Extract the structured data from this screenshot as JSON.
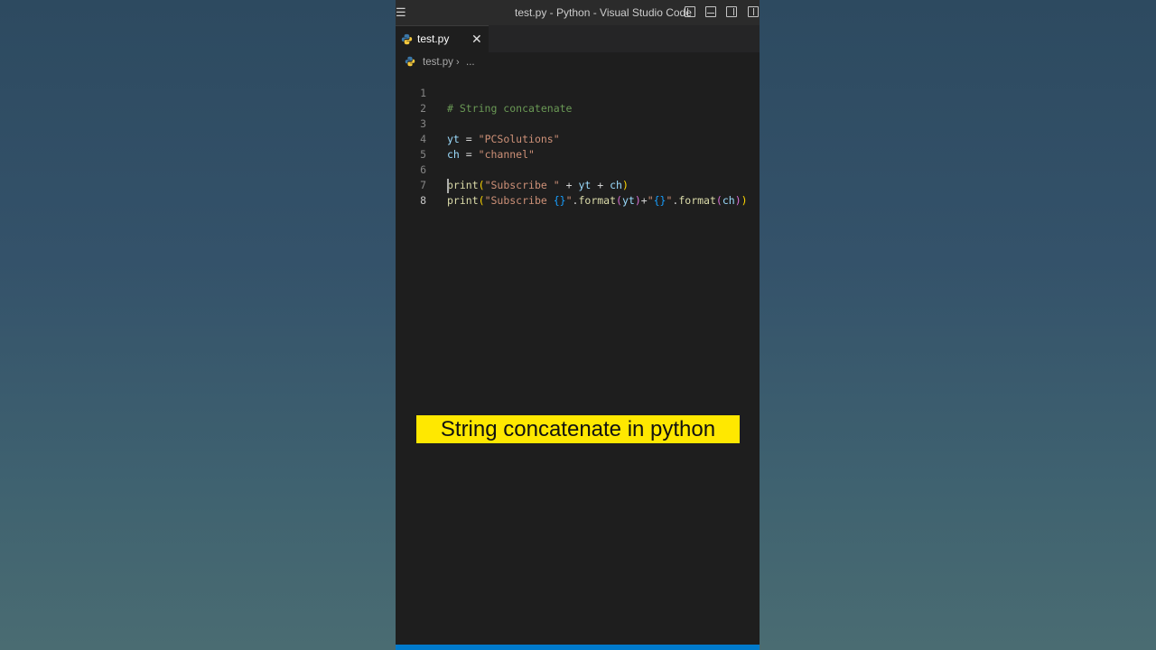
{
  "window": {
    "title": "test.py - Python - Visual Studio Code",
    "menu_icon": "hamburger-menu-icon",
    "layout_icons": [
      "toggle-primary-sidebar-icon",
      "toggle-panel-icon",
      "toggle-secondary-sidebar-icon",
      "customize-layout-icon"
    ]
  },
  "tab": {
    "label": "test.py",
    "close": "✕",
    "icon": "python-icon"
  },
  "breadcrumb": {
    "file": "test.py",
    "separator": "›",
    "more": "..."
  },
  "editor": {
    "line_numbers": [
      "1",
      "2",
      "3",
      "4",
      "5",
      "6",
      "7",
      "8"
    ],
    "active_line": "8",
    "code": {
      "l1_comment": "# String concatenate",
      "l3_var": "yt",
      "l3_eq": " = ",
      "l3_str": "\"PCSolutions\"",
      "l4_var": "ch",
      "l4_eq": " = ",
      "l4_str": "\"channel\"",
      "l6_fn": "print",
      "l6_open": "(",
      "l6_str": "\"Subscribe \"",
      "l6_plus1": " + ",
      "l6_v1": "yt",
      "l6_plus2": " + ",
      "l6_v2": "ch",
      "l6_close": ")",
      "l7_fn": "print",
      "l7_open": "(",
      "l7_str1a": "\"Subscribe ",
      "l7_brace1": "{}",
      "l7_str1b": "\"",
      "l7_dot1": ".",
      "l7_fmt1": "format",
      "l7_p1o": "(",
      "l7_v1": "yt",
      "l7_p1c": ")",
      "l7_plus": "+",
      "l7_str2a": "\"",
      "l7_brace2": "{}",
      "l7_str2b": "\"",
      "l7_dot2": ".",
      "l7_fmt2": "format",
      "l7_p2o": "(",
      "l7_v2": "ch",
      "l7_p2c": ")",
      "l7_close": ")"
    }
  },
  "caption": "String concatenate in python",
  "colors": {
    "caption_bg": "#ffe800",
    "editor_bg": "#1e1e1e",
    "statusbar": "#007acc",
    "comment": "#6a9955",
    "variable": "#9cdcfe",
    "string": "#ce9178",
    "function": "#dcdcaa"
  }
}
